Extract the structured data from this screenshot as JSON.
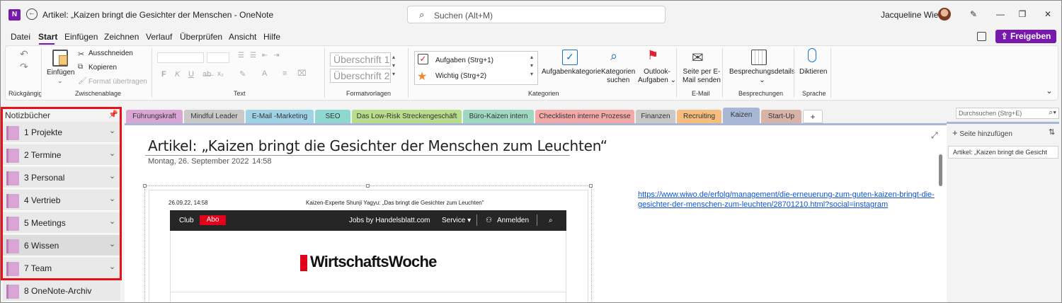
{
  "titlebar": {
    "app_icon": "N",
    "title": "Artikel: „Kaizen bringt die Gesichter der Menschen  -  OneNote",
    "search_placeholder": "Suchen (Alt+M)",
    "user": "Jacqueline Wiese",
    "icons": [
      "onenote-app-icon",
      "back-icon",
      "search-icon",
      "avatar",
      "pen-icon",
      "minimize-icon",
      "maximize-icon",
      "close-icon"
    ]
  },
  "menu": {
    "items": [
      "Datei",
      "Start",
      "Einfügen",
      "Zeichnen",
      "Verlauf",
      "Überprüfen",
      "Ansicht",
      "Hilfe"
    ],
    "active": "Start",
    "share": "Freigeben"
  },
  "ribbon": {
    "undo_group": "Rückgängig",
    "clipboard": {
      "paste": "Einfügen",
      "cut": "Ausschneiden",
      "copy": "Kopieren",
      "format_painter": "Format übertragen",
      "label": "Zwischenablage"
    },
    "text_group": "Text",
    "text_buttons": [
      "F",
      "K",
      "U"
    ],
    "styles": {
      "h1": "Überschrift 1",
      "h2": "Überschrift 2",
      "label": "Formatvorlagen"
    },
    "tags": {
      "todo": "Aufgaben (Strg+1)",
      "important": "Wichtig (Strg+2)",
      "task_category": "Aufgabenkategorie",
      "find_tags": [
        "Kategorien",
        "suchen"
      ],
      "outlook_tasks": [
        "Outlook-",
        "Aufgaben"
      ],
      "label": "Kategorien"
    },
    "email": {
      "send": [
        "Seite per E-",
        "Mail senden"
      ],
      "label": "E-Mail"
    },
    "meetings": {
      "details": "Besprechungsdetails",
      "label": "Besprechungen"
    },
    "voice": {
      "dictate": "Diktieren",
      "label": "Sprache"
    }
  },
  "notebooks": {
    "header": "Notizbücher",
    "items": [
      "1 Projekte",
      "2 Termine",
      "3 Personal",
      "4 Vertrieb",
      "5 Meetings",
      "6 Wissen",
      "7 Team",
      "8 OneNote-Archiv"
    ],
    "selected": "6 Wissen",
    "colors": {
      "icon": "#d8a6d4",
      "highlight": "#e8101a"
    }
  },
  "sections": {
    "tabs": [
      {
        "label": "Führungskraft",
        "color": "#d9a6d6"
      },
      {
        "label": "Mindful Leader",
        "color": "#c9c9c9"
      },
      {
        "label": "E-Mail -Marketing",
        "color": "#9ed3e6"
      },
      {
        "label": "SEO",
        "color": "#8ed8cf"
      },
      {
        "label": "Das Low-Risk Streckengeschäft",
        "color": "#b7dc8b"
      },
      {
        "label": "Büro-Kaizen intern",
        "color": "#9ed8c0"
      },
      {
        "label": "Checklisten interne Prozesse",
        "color": "#f4a9a9"
      },
      {
        "label": "Finanzen",
        "color": "#c9c9c9"
      },
      {
        "label": "Recruiting",
        "color": "#f5bd7e"
      },
      {
        "label": "Kaizen",
        "color": "#a9b7d6"
      },
      {
        "label": "Start-Up",
        "color": "#d8b3a8"
      },
      {
        "label": "+",
        "color": "#ffffff"
      }
    ],
    "active": "Kaizen",
    "search_placeholder": "Durchsuchen (Strg+E)"
  },
  "page": {
    "title": "Artikel: „Kaizen bringt die Gesichter der Menschen zum Leuchten“",
    "date": "Montag, 26. September 2022",
    "time": "14:58",
    "link": "https://www.wiwo.de/erfolg/management/die-erneuerung-zum-guten-kaizen-bringt-die-gesichter-der-menschen-zum-leuchten/28701210.html?social=instagram",
    "embedded": {
      "stamp": "26.09.22, 14:58",
      "headline": "Kaizen-Experte Shunji Yagyu: „Das bringt die Gesichter zum Leuchten\"",
      "nav_club": "Club",
      "nav_abo": "Abo",
      "nav_jobs": "Jobs by Handelsblatt.com",
      "nav_service": "Service ▾",
      "nav_login": "Anmelden",
      "logo": "WirtschaftsWoche",
      "colors": {
        "nav_bg": "#262626",
        "brand": "#e3001b"
      }
    }
  },
  "pages": {
    "add": "Seite hinzufügen",
    "items": [
      "Artikel: „Kaizen bringt die Gesicht"
    ]
  },
  "colors": {
    "accent": "#7719aa",
    "link": "#1155cc"
  }
}
